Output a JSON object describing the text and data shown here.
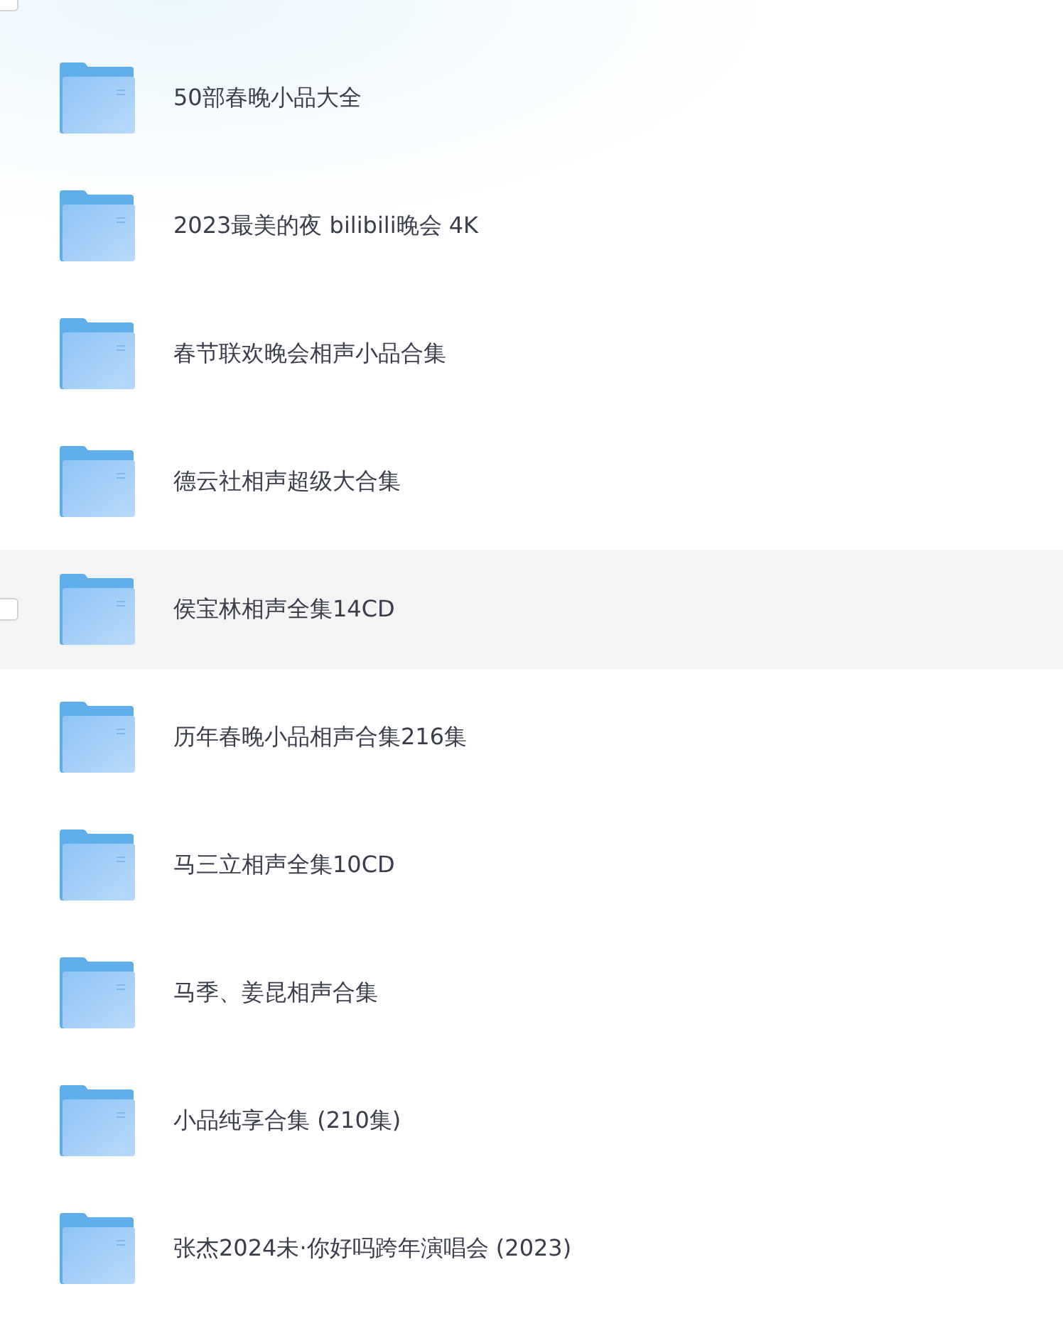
{
  "header": {
    "select_all_checked": false
  },
  "files": [
    {
      "name": "50部春晚小品大全",
      "hovered": false
    },
    {
      "name": "2023最美的夜 bilibili晚会 4K",
      "hovered": false
    },
    {
      "name": "春节联欢晚会相声小品合集",
      "hovered": false
    },
    {
      "name": "德云社相声超级大合集",
      "hovered": false
    },
    {
      "name": "侯宝林相声全集14CD",
      "hovered": true
    },
    {
      "name": "历年春晚小品相声合集216集",
      "hovered": false
    },
    {
      "name": "马三立相声全集10CD",
      "hovered": false
    },
    {
      "name": "马季、姜昆相声合集",
      "hovered": false
    },
    {
      "name": "小品纯享合集 (210集)",
      "hovered": false
    },
    {
      "name": "张杰2024未·你好吗跨年演唱会 (2023)",
      "hovered": false
    }
  ]
}
